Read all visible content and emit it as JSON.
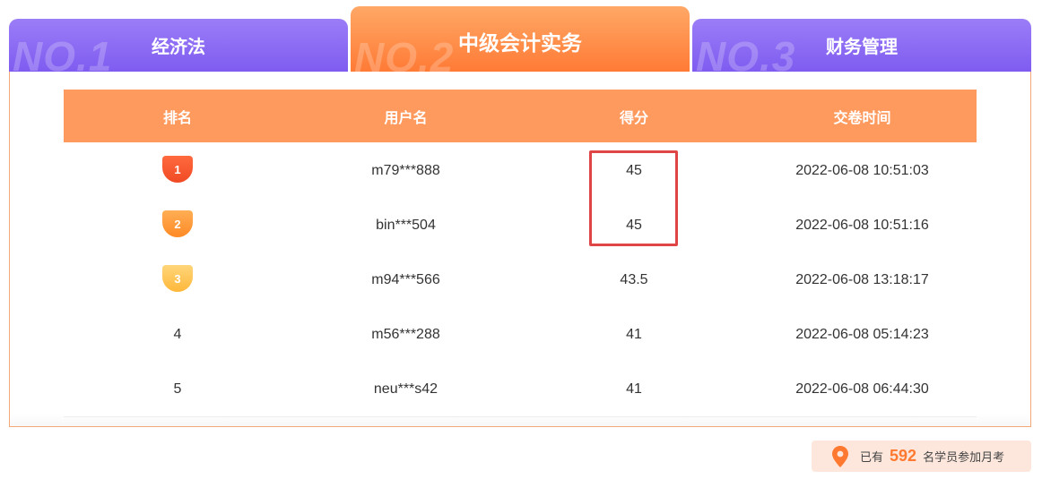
{
  "tabs": [
    {
      "no": "NO.1",
      "label": "经济法"
    },
    {
      "no": "NO.2",
      "label": "中级会计实务"
    },
    {
      "no": "NO.3",
      "label": "财务管理"
    }
  ],
  "table": {
    "headers": [
      "排名",
      "用户名",
      "得分",
      "交卷时间"
    ],
    "rows": [
      {
        "rank": "1",
        "user": "m79***888",
        "score": "45",
        "time": "2022-06-08 10:51:03"
      },
      {
        "rank": "2",
        "user": "bin***504",
        "score": "45",
        "time": "2022-06-08 10:51:16"
      },
      {
        "rank": "3",
        "user": "m94***566",
        "score": "43.5",
        "time": "2022-06-08 13:18:17"
      },
      {
        "rank": "4",
        "user": "m56***288",
        "score": "41",
        "time": "2022-06-08 05:14:23"
      },
      {
        "rank": "5",
        "user": "neu***s42",
        "score": "41",
        "time": "2022-06-08 06:44:30"
      }
    ]
  },
  "participants": {
    "prefix": "已有",
    "count": "592",
    "suffix": "名学员参加月考",
    "icon": "location-pin-icon"
  },
  "colors": {
    "accent_orange": "#ff9a5e",
    "tab_purple": "#8a68f3",
    "highlight_red": "#e04545"
  }
}
